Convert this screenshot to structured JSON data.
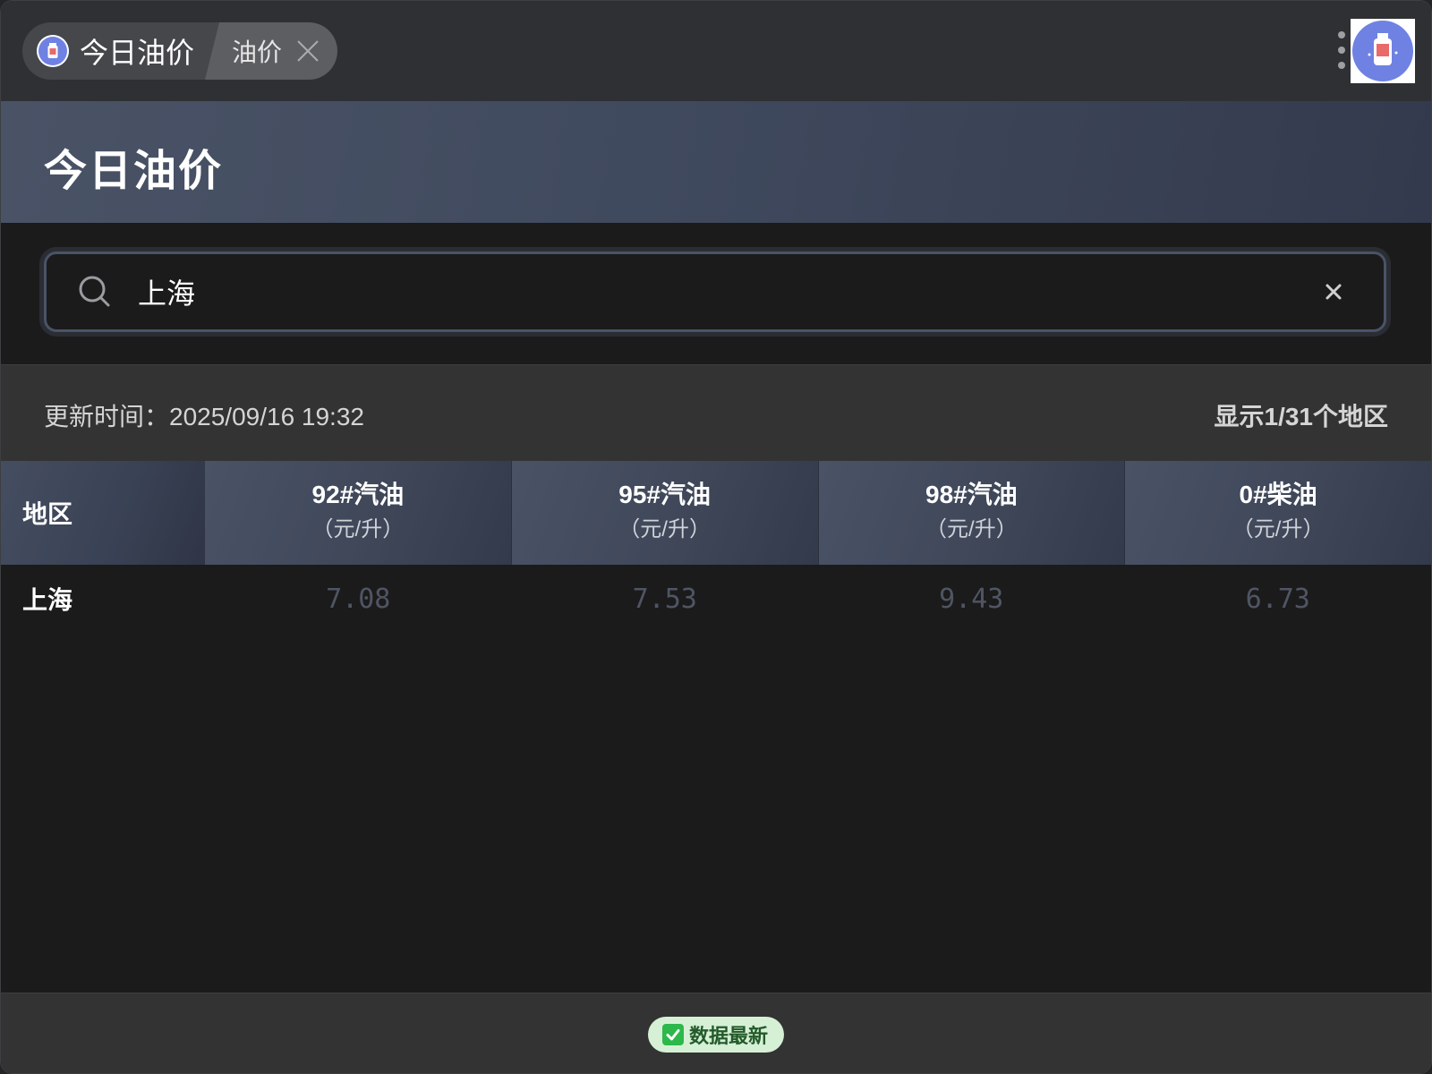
{
  "tabs": {
    "main_label": "今日油价",
    "second_label": "油价"
  },
  "page": {
    "title": "今日油价"
  },
  "search": {
    "value": "上海"
  },
  "info": {
    "update_time": "更新时间：2025/09/16 19:32",
    "region_count": "显示1/31个地区"
  },
  "table": {
    "columns": [
      {
        "title": "地区"
      },
      {
        "title": "92#汽油",
        "unit": "（元/升）"
      },
      {
        "title": "95#汽油",
        "unit": "（元/升）"
      },
      {
        "title": "98#汽油",
        "unit": "（元/升）"
      },
      {
        "title": "0#柴油",
        "unit": "（元/升）"
      }
    ],
    "rows": [
      {
        "region": "上海",
        "p92": "7.08",
        "p95": "7.53",
        "p98": "9.43",
        "p0": "6.73"
      }
    ]
  },
  "footer": {
    "status": "数据最新"
  },
  "icons": {
    "app": "oil-app-icon",
    "search": "search-icon",
    "clear": "clear-icon",
    "close": "close-icon",
    "more": "more-icon",
    "check": "check-icon"
  },
  "colors": {
    "accent": "#6f82e3",
    "header_gradient_start": "#4a5366",
    "price_text": "#4f5563",
    "badge_bg": "#d6f0d6",
    "badge_text": "#235a2a"
  }
}
